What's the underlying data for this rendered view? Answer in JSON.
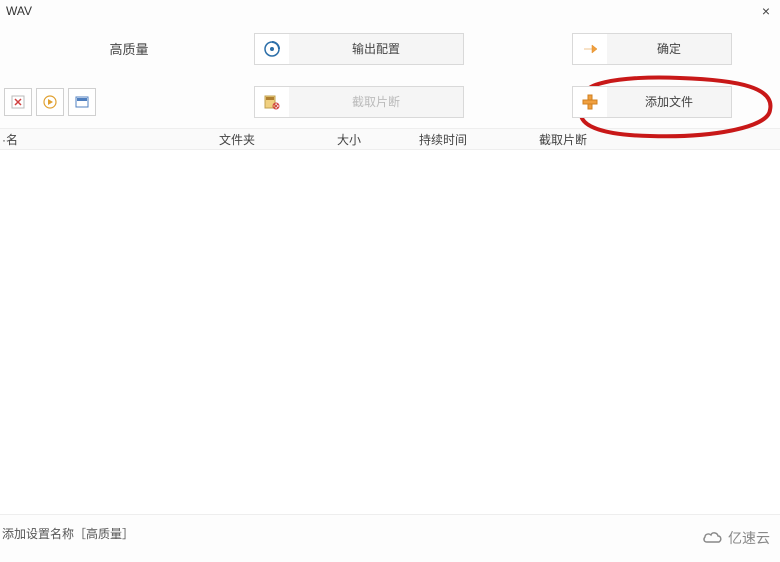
{
  "titlebar": {
    "title": "WAV",
    "close": "×"
  },
  "quality_label": "高质量",
  "buttons": {
    "output_config": "输出配置",
    "confirm": "确定",
    "cut_segment": "截取片断",
    "add_file": "添加文件"
  },
  "table": {
    "col_filename": "·名",
    "col_folder": "文件夹",
    "col_size": "大小",
    "col_duration": "持续时间",
    "col_cutseg": "截取片断"
  },
  "footer": {
    "text": "添加设置名称［高质量］"
  },
  "watermark": {
    "text": "亿速云"
  }
}
